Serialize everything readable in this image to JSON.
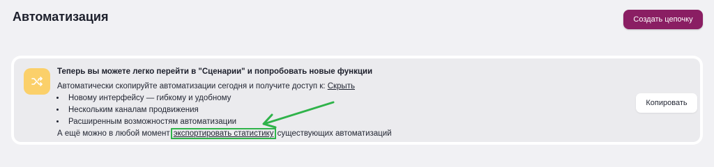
{
  "header": {
    "title": "Автоматизация",
    "create_button": "Создать цепочку"
  },
  "banner": {
    "icon": "shuffle-icon",
    "title": "Теперь вы можете легко перейти в \"Сценарии\" и попробовать новые функции",
    "intro": "Автоматически скопируйте автоматизации сегодня и получите доступ к: ",
    "hide_link": "Скрыть",
    "features": [
      "Новому интерфейсу — гибкому и удобному",
      "Нескольким каналам продвижения",
      "Расширенным возможностям автоматизации"
    ],
    "footer_prefix": "А ещё можно в любой момент ",
    "export_link": "экспортировать статистику",
    "footer_suffix": " существующих автоматизаций",
    "copy_button": "Копировать"
  },
  "colors": {
    "accent": "#8a1e63",
    "icon_bg": "#fbd06a",
    "highlight": "#2fb34a"
  }
}
